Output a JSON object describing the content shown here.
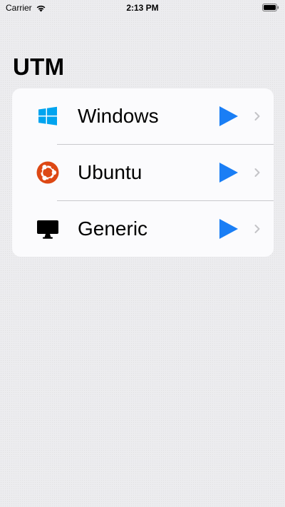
{
  "status_bar": {
    "carrier": "Carrier",
    "time": "2:13 PM",
    "wifi_icon": "wifi-icon",
    "battery_icon": "battery-icon"
  },
  "page": {
    "title": "UTM"
  },
  "vms": [
    {
      "name": "Windows",
      "icon": "windows-logo-icon",
      "icon_color": "#00a4ef"
    },
    {
      "name": "Ubuntu",
      "icon": "ubuntu-logo-icon",
      "icon_color": "#dd4814"
    },
    {
      "name": "Generic",
      "icon": "monitor-icon",
      "icon_color": "#000000"
    }
  ],
  "colors": {
    "accent": "#1a7ef5",
    "chevron": "#c4c4c7",
    "background": "#ececef",
    "card": "#fbfbfd",
    "separator": "#c8c8cc"
  }
}
